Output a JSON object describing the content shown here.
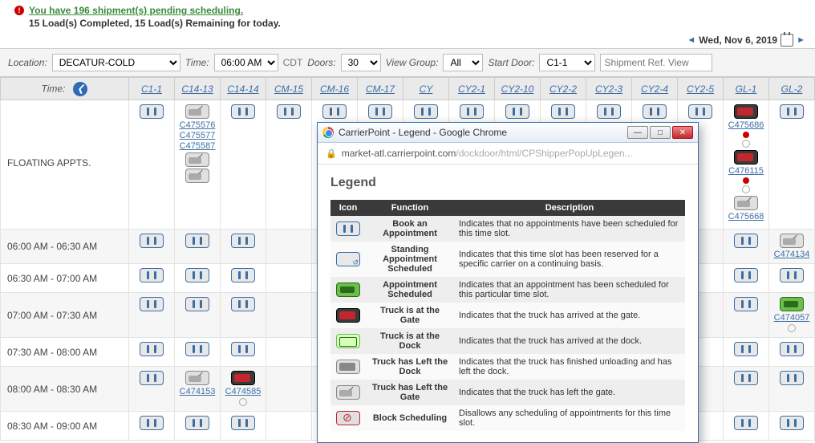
{
  "alert": {
    "pending_text": "You have 196 shipment(s) pending scheduling.",
    "loads_text": "15 Load(s) Completed, 15 Load(s) Remaining for today."
  },
  "date_nav": {
    "date": "Wed, Nov 6, 2019"
  },
  "filters": {
    "location_label": "Location:",
    "location_value": "DECATUR-COLD",
    "time_label": "Time:",
    "time_value": "06:00 AM",
    "tz": "CDT",
    "doors_label": "Doors:",
    "doors_value": "30",
    "viewgroup_label": "View Group:",
    "viewgroup_value": "All",
    "startdoor_label": "Start Door:",
    "startdoor_value": "C1-1",
    "refview_placeholder": "Shipment Ref. View"
  },
  "columns": [
    "C1-1",
    "C14-13",
    "C14-14",
    "CM-15",
    "CM-16",
    "CM-17",
    "CY",
    "CY2-1",
    "CY2-10",
    "CY2-2",
    "CY2-3",
    "CY2-4",
    "CY2-5",
    "GL-1",
    "GL-2"
  ],
  "time_col_header": "Time:",
  "rows": {
    "floating_label": "FLOATING APPTS.",
    "floating_shipments_c14_13": [
      "C475576",
      "C475577",
      "C475587"
    ],
    "gl1_shipments": [
      "C475686",
      "C476115",
      "C475668"
    ],
    "slots": [
      "06:00 AM - 06:30 AM",
      "06:30 AM - 07:00 AM",
      "07:00 AM - 07:30 AM",
      "07:30 AM - 08:00 AM",
      "08:00 AM - 08:30 AM",
      "08:30 AM - 09:00 AM"
    ],
    "ship_474134": "C474134",
    "ship_474057": "C474057",
    "ship_474153": "C474153",
    "ship_474585": "C474585"
  },
  "popup": {
    "title": "CarrierPoint - Legend - Google Chrome",
    "url_host": "market-atl.carrierpoint.com",
    "url_path": "/dockdoor/html/CPShipperPopUpLegen...",
    "heading": "Legend",
    "th_icon": "Icon",
    "th_func": "Function",
    "th_desc": "Description",
    "items": [
      {
        "icon": "book",
        "func": "Book an Appointment",
        "desc": "Indicates that no appointments have been scheduled for this time slot."
      },
      {
        "icon": "standing",
        "func": "Standing Appointment Scheduled",
        "desc": "Indicates that this time slot has been reserved for a specific carrier on a continuing basis."
      },
      {
        "icon": "sched",
        "func": "Appointment Scheduled",
        "desc": "Indicates that an appointment has been scheduled for this particular time slot."
      },
      {
        "icon": "gate",
        "func": "Truck is at the Gate",
        "desc": "Indicates that the truck has arrived at the gate."
      },
      {
        "icon": "dock",
        "func": "Truck is at the Dock",
        "desc": "Indicates that the truck has arrived at the dock."
      },
      {
        "icon": "left-dock",
        "func": "Truck has Left the Dock",
        "desc": "Indicates that the truck has finished unloading and has left the dock."
      },
      {
        "icon": "left-gate",
        "func": "Truck has Left the Gate",
        "desc": "Indicates that the truck has left the gate."
      },
      {
        "icon": "block",
        "func": "Block Scheduling",
        "desc": "Disallows any scheduling of appointments for this time slot."
      }
    ]
  }
}
